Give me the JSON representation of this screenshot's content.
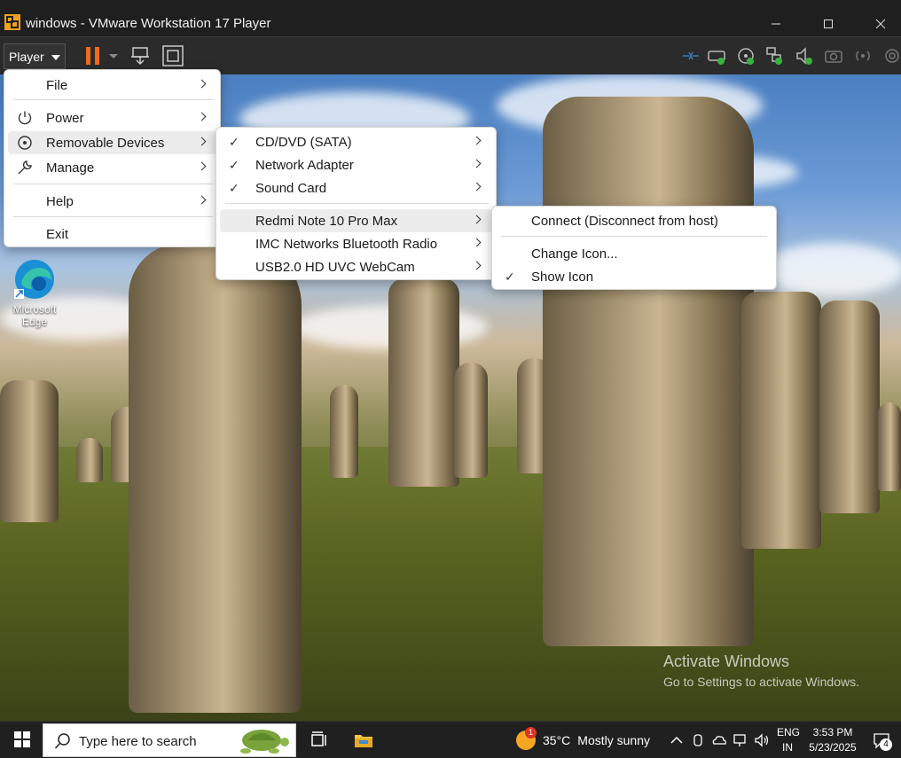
{
  "window": {
    "title": "windows - VMware Workstation 17 Player",
    "app_icon": "vmware-icon",
    "controls": [
      "minimize-icon",
      "maximize-icon",
      "close-icon"
    ]
  },
  "toolbar": {
    "player_label": "Player",
    "icons": [
      "pause-icon",
      "dropdown-icon",
      "send-ctrl-alt-del-icon",
      "full-screen-icon"
    ],
    "device_icons": [
      "network-icon",
      "hard-disk-icon",
      "cd-dvd-icon",
      "network-adapter-icon",
      "sound-icon",
      "camera-icon",
      "wireless-icon",
      "settings-icon"
    ]
  },
  "player_menu": {
    "items": [
      {
        "label": "File"
      },
      {
        "label": "Power"
      },
      {
        "label": "Removable Devices"
      },
      {
        "label": "Manage"
      },
      {
        "label": "Help"
      },
      {
        "label": "Exit"
      }
    ]
  },
  "devices_menu": {
    "items": [
      {
        "label": "CD/DVD (SATA)",
        "checked": true
      },
      {
        "label": "Network Adapter",
        "checked": true
      },
      {
        "label": "Sound Card",
        "checked": true
      },
      {
        "label": "Redmi Note 10 Pro Max",
        "checked": false
      },
      {
        "label": "IMC Networks Bluetooth Radio",
        "checked": false
      },
      {
        "label": "USB2.0 HD UVC WebCam",
        "checked": false
      }
    ]
  },
  "device_submenu": {
    "items": [
      {
        "label": "Connect (Disconnect from host)",
        "checked": false
      },
      {
        "label": "Change Icon...",
        "checked": false
      },
      {
        "label": "Show Icon",
        "checked": true
      }
    ]
  },
  "desktop": {
    "icons": [
      {
        "label_line1": "Microsoft",
        "label_line2": "Edge",
        "icon": "edge-icon"
      }
    ],
    "watermark_line1": "Activate Windows",
    "watermark_line2": "Go to Settings to activate Windows."
  },
  "taskbar": {
    "search_placeholder": "Type here to search",
    "weather_temp": "35°C",
    "weather_condition": "Mostly sunny",
    "weather_badge": "1",
    "lang_line1": "ENG",
    "lang_line2": "IN",
    "time": "3:53 PM",
    "date": "5/23/2025",
    "notification_count": "4"
  }
}
